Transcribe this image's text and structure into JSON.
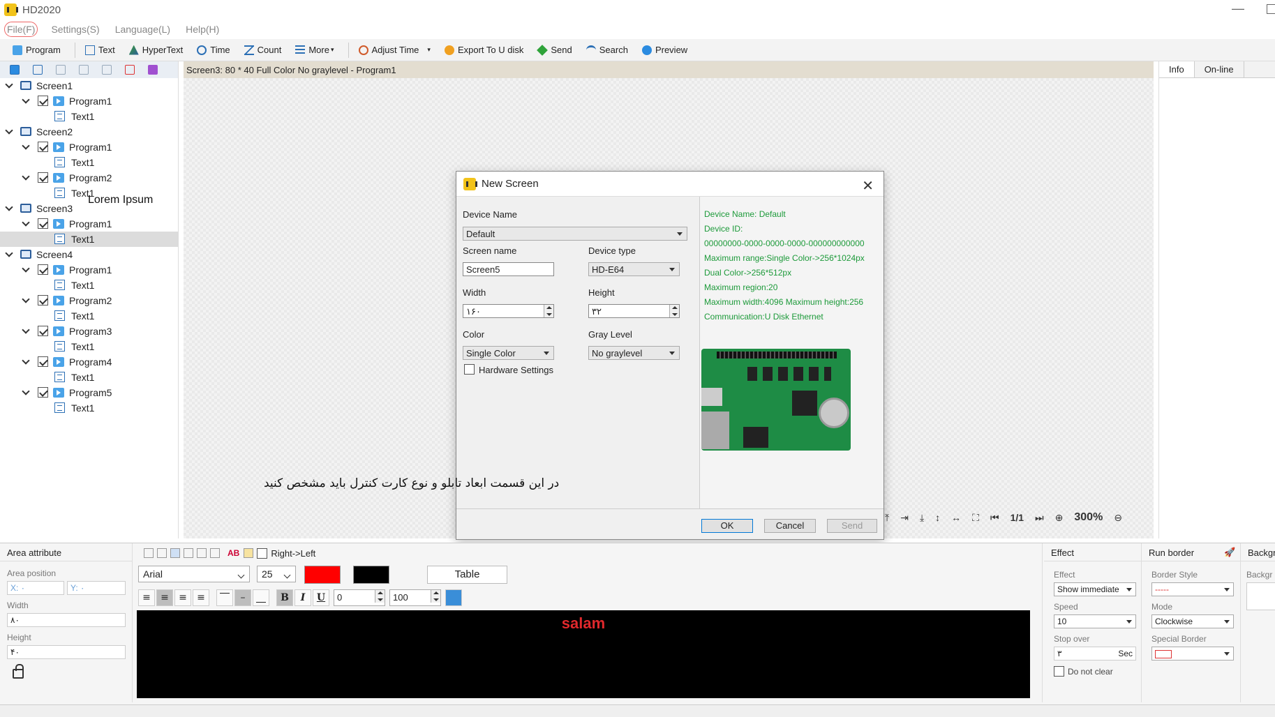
{
  "window": {
    "title": "HD2020"
  },
  "menu": {
    "items": [
      "File(F)",
      "Settings(S)",
      "Language(L)",
      "Help(H)"
    ]
  },
  "toolbar": {
    "program": "Program",
    "text": "Text",
    "hypertext": "HyperText",
    "time": "Time",
    "count": "Count",
    "more": "More",
    "adjust_time": "Adjust Time",
    "export": "Export To U disk",
    "send": "Send",
    "search": "Search",
    "preview": "Preview"
  },
  "tree": {
    "nodes": [
      {
        "label": "Screen1"
      },
      {
        "label": "Program1"
      },
      {
        "label": "Text1"
      },
      {
        "label": "Screen2"
      },
      {
        "label": "Program1"
      },
      {
        "label": "Text1"
      },
      {
        "label": "Program2"
      },
      {
        "label": "Text1"
      },
      {
        "label": "Screen3"
      },
      {
        "label": "Program1"
      },
      {
        "label": "Text1"
      },
      {
        "label": "Screen4"
      },
      {
        "label": "Program1"
      },
      {
        "label": "Text1"
      },
      {
        "label": "Program2"
      },
      {
        "label": "Text1"
      },
      {
        "label": "Program3"
      },
      {
        "label": "Text1"
      },
      {
        "label": "Program4"
      },
      {
        "label": "Text1"
      },
      {
        "label": "Program5"
      },
      {
        "label": "Text1"
      }
    ],
    "overlay_text": "Lorem Ipsum"
  },
  "canvas": {
    "header": "Screen3: 80 * 40 Full Color No graylevel - Program1",
    "page": "1/1",
    "zoom": "300%"
  },
  "info_panel": {
    "tabs": [
      "Info",
      "On-line"
    ]
  },
  "dialog": {
    "title": "New Screen",
    "device_name_label": "Device Name",
    "device_name_value": "Default",
    "screen_name_label": "Screen name",
    "screen_name_value": "Screen5",
    "device_type_label": "Device type",
    "device_type_value": "HD-E64",
    "width_label": "Width",
    "width_value": "۱۶۰",
    "height_label": "Height",
    "height_value": "۳۲",
    "color_label": "Color",
    "color_value": "Single Color",
    "gray_label": "Gray Level",
    "gray_value": "No graylevel",
    "hardware_label": "Hardware Settings",
    "info": [
      "Device Name: Default",
      "Device ID:",
      "00000000-0000-0000-0000-000000000000",
      "Maximum range:Single Color->256*1024px",
      "Dual Color->256*512px",
      "Maximum region:20",
      "Maximum width:4096 Maximum height:256",
      "Communication:U Disk  Ethernet"
    ],
    "ok": "OK",
    "cancel": "Cancel",
    "send": "Send",
    "annotation": "در این قسمت ابعاد تابلو و نوع کارت کنترل باید مشخص کنید"
  },
  "area": {
    "title": "Area attribute",
    "position_label": "Area position",
    "x": "X: ۰",
    "y": "Y: ۰",
    "width_label": "Width",
    "width_value": "۸۰",
    "height_label": "Height",
    "height_value": "۴۰"
  },
  "editor": {
    "rtl_label": "Right->Left",
    "ab_label": "AB",
    "font": "Arial",
    "size": "25",
    "text_color": "#ff0000",
    "bg_color": "#000000",
    "table_label": "Table",
    "spacing": "0",
    "scale": "100",
    "bold": "B",
    "italic": "I",
    "underline": "U",
    "preview_text": "salam"
  },
  "effect": {
    "title": "Effect",
    "effect_label": "Effect",
    "effect_value": "Show immediate",
    "speed_label": "Speed",
    "speed_value": "10",
    "stop_label": "Stop over",
    "stop_value": "۳",
    "stop_unit": "Sec",
    "noclear_label": "Do not clear"
  },
  "run_border": {
    "title": "Run border",
    "style_label": "Border Style",
    "style_value": "-----",
    "mode_label": "Mode",
    "mode_value": "Clockwise",
    "special_label": "Special Border"
  },
  "background": {
    "title": "Backgr",
    "label": "Backgr"
  }
}
